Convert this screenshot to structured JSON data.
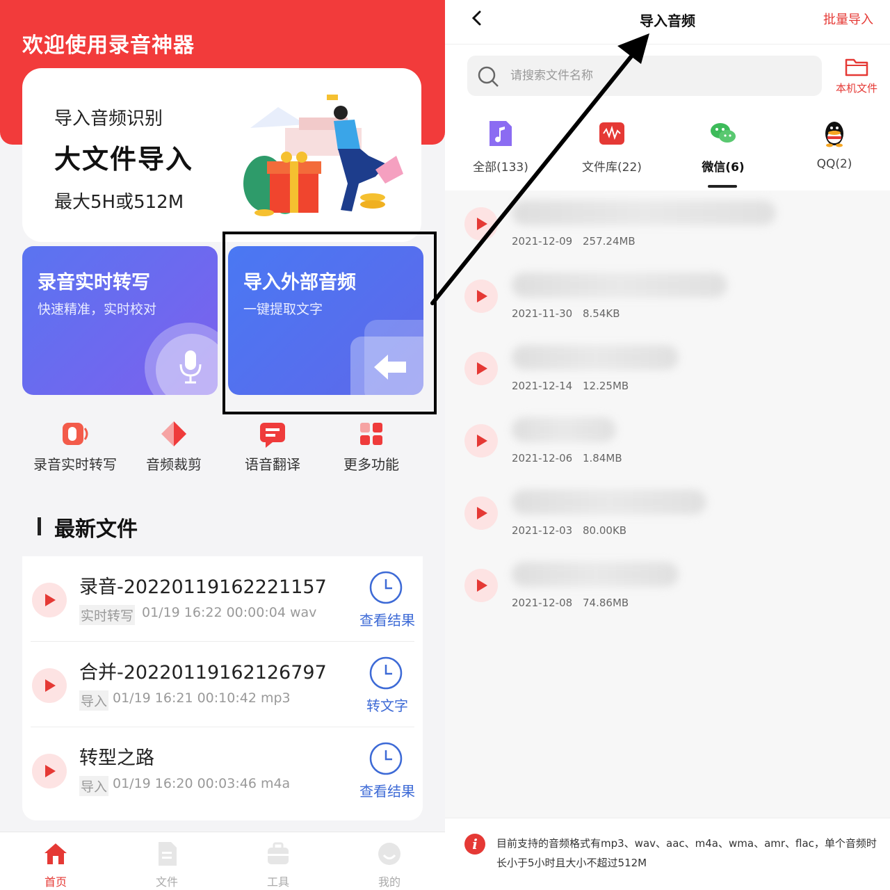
{
  "left": {
    "app_title": "欢迎使用录音神器",
    "hero": {
      "line1": "导入音频识别",
      "line2": "大文件导入",
      "line3": "最大5H或512M"
    },
    "feature_cards": [
      {
        "title": "录音实时转写",
        "subtitle": "快速精准，实时校对"
      },
      {
        "title": "导入外部音频",
        "subtitle": "一键提取文字"
      }
    ],
    "tools": [
      {
        "label": "录音实时转写",
        "icon": "record-transcribe-icon"
      },
      {
        "label": "音频裁剪",
        "icon": "audio-cut-icon"
      },
      {
        "label": "语音翻译",
        "icon": "voice-translate-icon"
      },
      {
        "label": "更多功能",
        "icon": "more-features-icon"
      }
    ],
    "section_title": "最新文件",
    "files": [
      {
        "name": "录音-20220119162221157",
        "tag": "实时转写",
        "meta": "01/19 16:22 00:00:04 wav",
        "action": "查看结果"
      },
      {
        "name": "合并-20220119162126797",
        "tag": "导入",
        "meta": "01/19 16:21 00:10:42 mp3",
        "action": "转文字"
      },
      {
        "name": "转型之路",
        "tag": "导入",
        "meta": "01/19 16:20 00:03:46 m4a",
        "action": "查看结果"
      }
    ],
    "nav": [
      {
        "label": "首页",
        "active": true
      },
      {
        "label": "文件",
        "active": false
      },
      {
        "label": "工具",
        "active": false
      },
      {
        "label": "我的",
        "active": false
      }
    ]
  },
  "right": {
    "title": "导入音频",
    "batch_import": "批量导入",
    "search_placeholder": "请搜索文件名称",
    "local_file": "本机文件",
    "categories": [
      {
        "label": "全部(133)",
        "icon": "music-note-icon"
      },
      {
        "label": "文件库(22)",
        "icon": "file-library-icon"
      },
      {
        "label": "微信(6)",
        "icon": "wechat-icon",
        "active": true
      },
      {
        "label": "QQ(2)",
        "icon": "qq-icon"
      }
    ],
    "audio_files": [
      {
        "date": "2021-12-09",
        "size": "257.24MB"
      },
      {
        "date": "2021-11-30",
        "size": "8.54KB"
      },
      {
        "date": "2021-12-14",
        "size": "12.25MB"
      },
      {
        "date": "2021-12-06",
        "size": "1.84MB"
      },
      {
        "date": "2021-12-03",
        "size": "80.00KB"
      },
      {
        "date": "2021-12-08",
        "size": "74.86MB"
      }
    ],
    "notice": "目前支持的音频格式有mp3、wav、aac、m4a、wma、amr、flac，单个音频时长小于5小时且大小不超过512M"
  },
  "colors": {
    "brand_red": "#f23b3b",
    "accent_blue": "#3d6ad6",
    "card_gradient_start": "#4a78f3",
    "card_gradient_end": "#7d60ee"
  }
}
